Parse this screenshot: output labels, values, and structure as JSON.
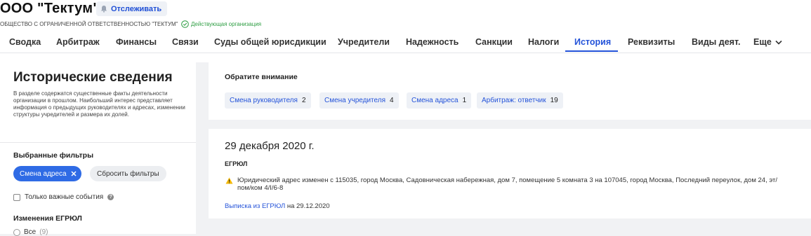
{
  "company": {
    "name": "ООО \"Тектум\"",
    "follow_label": "Отслеживать",
    "full_name": "ОБЩЕСТВО С ОГРАНИЧЕННОЙ ОТВЕТСТВЕННОСТЬЮ \"ТЕКТУМ\"",
    "status": "Действующая организация"
  },
  "tabs": [
    {
      "label": "Сводка"
    },
    {
      "label": "Арбитраж"
    },
    {
      "label": "Финансы"
    },
    {
      "label": "Связи"
    },
    {
      "label": "Суды общей юрисдикции"
    },
    {
      "label": "Учредители"
    },
    {
      "label": "Надежность"
    },
    {
      "label": "Санкции"
    },
    {
      "label": "Налоги"
    },
    {
      "label": "История"
    },
    {
      "label": "Реквизиты"
    },
    {
      "label": "Виды деят."
    },
    {
      "label": "Еще"
    }
  ],
  "active_tab": "История",
  "sidebar": {
    "title": "Исторические сведения",
    "description": "В разделе содержатся существенные факты деятельности организации в прошлом. Наибольший интерес представляет информация о предыдущих руководителях и адресах, изменении структуры учредителей и размера их долей.",
    "filters_label": "Выбранные фильтры",
    "active_filter": "Смена адреса",
    "reset_label": "Сбросить фильтры",
    "important_only_label": "Только важные события",
    "egrul_changes_label": "Изменения ЕГРЮЛ",
    "radio_all_label": "Все",
    "radio_all_count": "(9)"
  },
  "attention": {
    "title": "Обратите внимание",
    "items": [
      {
        "label": "Смена руководителя",
        "count": "2"
      },
      {
        "label": "Смена учредителя",
        "count": "4"
      },
      {
        "label": "Смена адреса",
        "count": "1"
      },
      {
        "label": "Арбитраж: ответчик",
        "count": "19"
      }
    ]
  },
  "event": {
    "date": "29 декабря 2020 г.",
    "source": "ЕГРЮЛ",
    "text": "Юридический адрес изменен с 115035, город Москва, Садовническая набережная, дом 7, помещение 5 комната 3 на 107045, город Москва, Последний переулок, дом 24, эт/пом/ком 4/I/6-8",
    "link_label": "Выписка из ЕГРЮЛ",
    "link_suffix": " на 29.12.2020"
  },
  "colors": {
    "accent": "#2453d9",
    "status_green": "#2f9e44",
    "chip_blue": "#2f6be5",
    "warning": "#f2b705"
  },
  "icons": [
    "bell-icon",
    "check-circle-icon",
    "chevron-down-icon",
    "close-icon",
    "help-icon",
    "warning-icon"
  ]
}
